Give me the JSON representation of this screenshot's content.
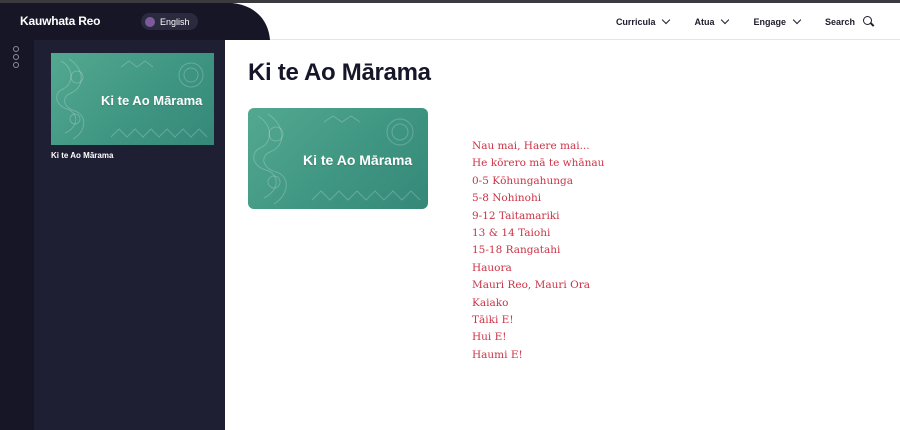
{
  "header": {
    "brand": "Kauwhata Reo",
    "language": {
      "label": "English",
      "color": "#7e5a9c"
    },
    "nav": [
      {
        "label": "Curricula",
        "icon": "chevron-down-icon"
      },
      {
        "label": "Atua",
        "icon": "chevron-down-icon"
      },
      {
        "label": "Engage",
        "icon": "chevron-down-icon"
      },
      {
        "label": "Search",
        "icon": "search-icon"
      }
    ]
  },
  "sidebar": {
    "menu_icon": "more-dots-icon",
    "thumbnail_text": "Ki te Ao Mārama",
    "caption": "Ki te Ao Mārama"
  },
  "main": {
    "title": "Ki te Ao Mārama",
    "thumbnail_text": "Ki te Ao Mārama",
    "links": [
      "Nau mai, Haere mai...",
      "He kōrero mā te whānau",
      "0-5 Kōhungahunga",
      "5-8 Nohinohi",
      "9-12 Taitamariki",
      "13 & 14 Taiohi",
      "15-18 Rangatahi",
      "Hauora",
      "Mauri Reo, Mauri Ora",
      "Kaiako",
      "Tāiki E!",
      "Hui E!",
      "Haumi E!"
    ]
  },
  "colors": {
    "dark_navy": "#1e1f33",
    "rail": "#161626",
    "link": "#cc3346",
    "banner_teal": "#46a088"
  }
}
